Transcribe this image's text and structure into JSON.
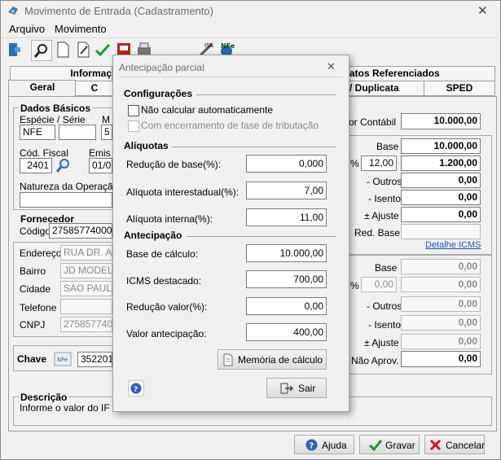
{
  "window": {
    "title": "Movimento de Entrada (Cadastramento)",
    "close_glyph": "✕"
  },
  "menu": [
    "Arquivo",
    "Movimento"
  ],
  "toolbar": {
    "icons": [
      "exit-icon",
      "search-icon",
      "new-document-icon",
      "edit-icon",
      "confirm-icon",
      "pdf-icon",
      "print-icon",
      "tools-icon",
      "nfe-icon"
    ]
  },
  "tabs": {
    "row1": [
      "Informaç",
      "atos Referenciados"
    ],
    "row2": [
      "Geral",
      "C",
      "/ Duplicata",
      "SPED"
    ]
  },
  "main": {
    "dados_basicos": "Dados Básicos",
    "especie_serie_label": "Espécie  /  Série",
    "especie_value": "NFE",
    "m_label": "M",
    "m_value": "5",
    "cod_fiscal_label": "Cód. Fiscal",
    "cod_fiscal_value": "2401",
    "emis_label": "Emis",
    "emis_value": "01/0",
    "natureza_label": "Natureza da Operação",
    "fornecedor": "Fornecedor",
    "codigo_label": "Código",
    "codigo_value": "275857740001",
    "endereco_label": "Endereço",
    "endereco_value": "RUA DR. A",
    "bairro_label": "Bairro",
    "bairro_value": "JD MODEL",
    "cidade_label": "Cidade",
    "cidade_value": "SAO PAULO",
    "telefone_label": "Telefone",
    "cnpj_label": "CNPJ",
    "cnpj_value": "275857740",
    "chave_label": "Chave",
    "chave_value": "352201",
    "descricao": "Descrição",
    "descricao_text": "Informe o valor do IF"
  },
  "right": {
    "valor_contabil_label": "or Contábil",
    "valor_contabil": "10.000,00",
    "base_label": "Base",
    "base_value": "10.000,00",
    "aliq_pct": "%",
    "aliq_value": "12,00",
    "icms_value": "1.200,00",
    "outros_label": "- Outros",
    "outros_value": "0,00",
    "isento_label": "- Isento",
    "isento_value": "0,00",
    "ajuste_label": "± Ajuste",
    "ajuste_value": "0,00",
    "red_base_label": "Red. Base",
    "detalhe_link": "Detalhe ICMS",
    "base2_label": "Base",
    "base2_value": "0,00",
    "pct2": "%",
    "aliq2_value": "0,00",
    "icms2_value": "0,00",
    "outros2_label": "- Outros",
    "outros2_value": "0,00",
    "isento2_label": "- Isento",
    "isento2_value": "0,00",
    "ajuste2_label": "± Ajuste",
    "ajuste2_value": "0,00",
    "nao_aprov_label": "Não Aprov.",
    "nao_aprov_value": "0,00"
  },
  "dialog": {
    "title": "Antecipação parcial",
    "close_glyph": "✕",
    "configuracoes": "Configurações",
    "chk1_label": "Não calcular automaticamente",
    "chk2_label": "Com encerramento de fase de tributação",
    "aliquotas": "Alíquotas",
    "reducao_base_label": "Redução de base(%):",
    "reducao_base_value": "0,000",
    "aliq_inter_label": "Alíquota interestadual(%):",
    "aliq_inter_value": "7,00",
    "aliq_interna_label": "Alíquota interna(%):",
    "aliq_interna_value": "11,00",
    "antecipacao": "Antecipação",
    "base_calc_label": "Base de cálculo:",
    "base_calc_value": "10.000,00",
    "icms_dest_label": "ICMS destacado:",
    "icms_dest_value": "700,00",
    "reducao_valor_label": "Redução valor(%):",
    "reducao_valor_value": "0,00",
    "valor_antecip_label": "Valor antecipação:",
    "valor_antecip_value": "400,00",
    "memoria_btn": "Memória de cálculo",
    "sair_btn": "Sair"
  },
  "footer": {
    "ajuda": "Ajuda",
    "gravar": "Gravar",
    "cancelar": "Cancelar"
  }
}
